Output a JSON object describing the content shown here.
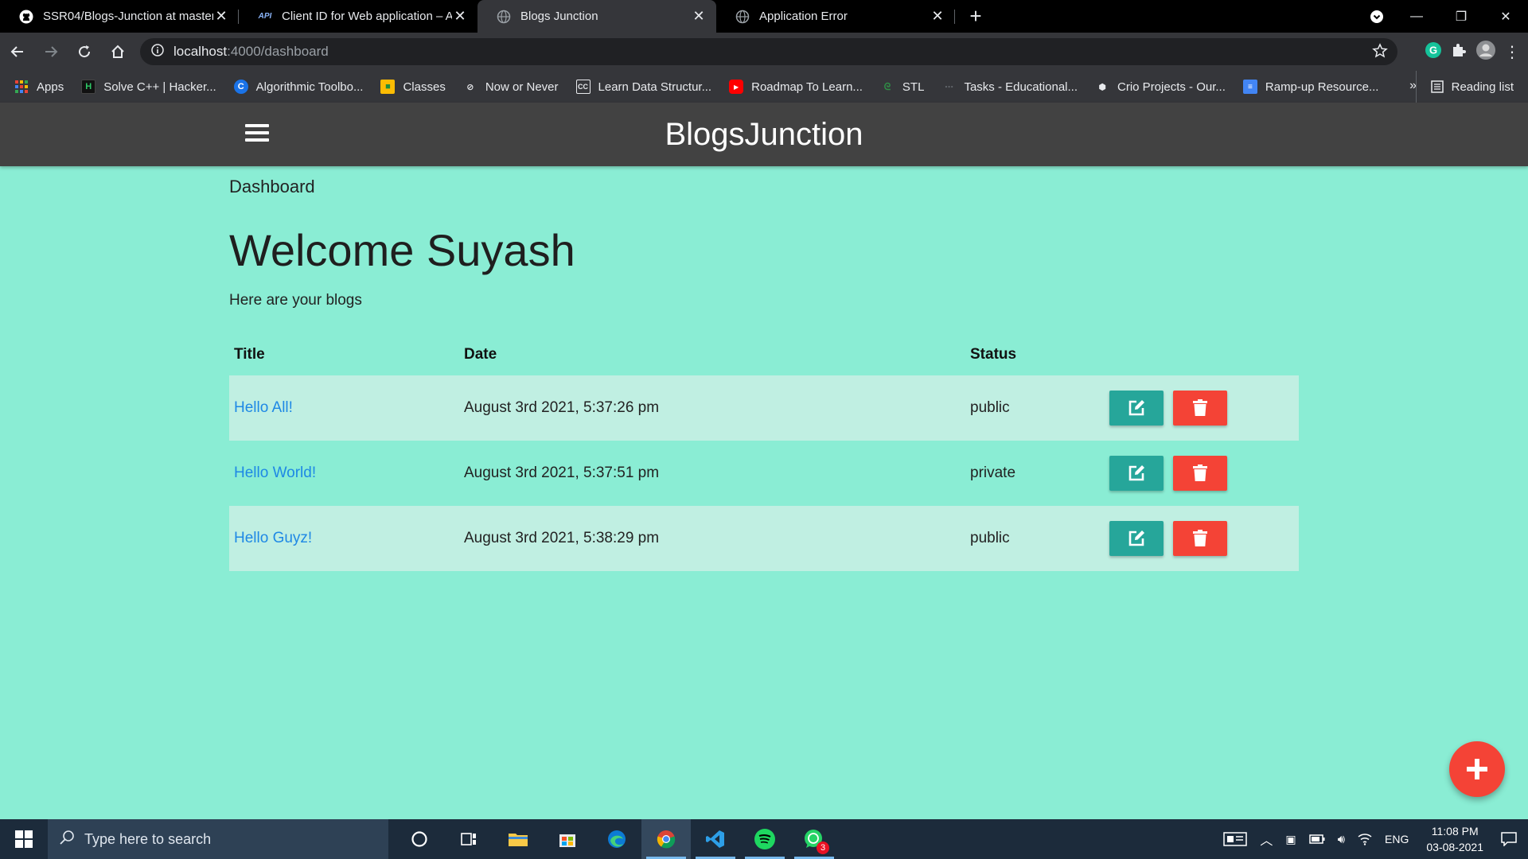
{
  "browser": {
    "tabs": [
      {
        "title": "SSR04/Blogs-Junction at master",
        "icon": "github-icon"
      },
      {
        "title": "Client ID for Web application – A",
        "icon": "api-icon"
      },
      {
        "title": "Blogs Junction",
        "icon": "globe-icon",
        "active": true
      },
      {
        "title": "Application Error",
        "icon": "globe-icon"
      }
    ],
    "url_host": "localhost",
    "url_path": ":4000/dashboard",
    "bookmarks": [
      {
        "label": "Apps",
        "icon": "apps-grid-icon"
      },
      {
        "label": "Solve C++ | Hacker...",
        "icon": "hackerrank-icon"
      },
      {
        "label": "Algorithmic Toolbo...",
        "icon": "coursera-icon"
      },
      {
        "label": "Classes",
        "icon": "classroom-icon"
      },
      {
        "label": "Now or Never",
        "icon": "bookmark-icon"
      },
      {
        "label": "Learn Data Structur...",
        "icon": "cc-icon"
      },
      {
        "label": "Roadmap To Learn...",
        "icon": "youtube-icon"
      },
      {
        "label": "STL",
        "icon": "gfg-icon"
      },
      {
        "label": "Tasks - Educational...",
        "icon": "link-icon"
      },
      {
        "label": "Crio Projects - Our...",
        "icon": "crio-icon"
      },
      {
        "label": "Ramp-up Resource...",
        "icon": "docs-icon"
      }
    ],
    "more_label": "»",
    "reading_list": "Reading list"
  },
  "app": {
    "brand": "BlogsJunction",
    "breadcrumb": "Dashboard",
    "welcome": "Welcome Suyash",
    "subtitle": "Here are your blogs",
    "columns": {
      "title": "Title",
      "date": "Date",
      "status": "Status"
    },
    "blogs": [
      {
        "title": "Hello All!",
        "date": "August 3rd 2021, 5:37:26 pm",
        "status": "public"
      },
      {
        "title": "Hello World!",
        "date": "August 3rd 2021, 5:37:51 pm",
        "status": "private"
      },
      {
        "title": "Hello Guyz!",
        "date": "August 3rd 2021, 5:38:29 pm",
        "status": "public"
      }
    ],
    "colors": {
      "page_bg": "#8aedd4",
      "appbar": "#424242",
      "edit": "#26a69a",
      "delete": "#f44336",
      "link": "#1e88e5"
    }
  },
  "taskbar": {
    "search_placeholder": "Type here to search",
    "language": "ENG",
    "time": "11:08 PM",
    "date": "03-08-2021",
    "whatsapp_badge": "3"
  }
}
